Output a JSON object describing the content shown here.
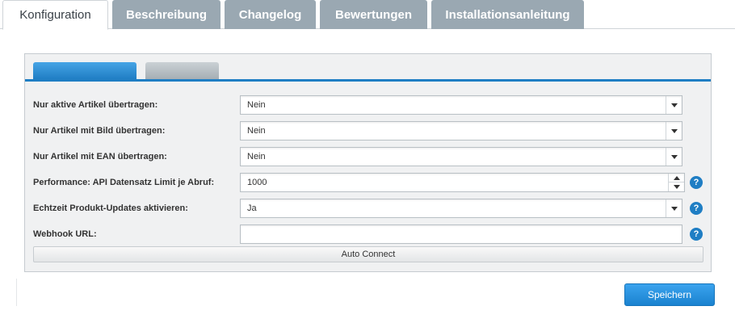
{
  "top_tabs": [
    {
      "label": "Konfiguration",
      "active": true
    },
    {
      "label": "Beschreibung",
      "active": false
    },
    {
      "label": "Changelog",
      "active": false
    },
    {
      "label": "Bewertungen",
      "active": false
    },
    {
      "label": "Installationsanleitung",
      "active": false
    }
  ],
  "form": {
    "rows": [
      {
        "label": "Nur aktive Artikel übertragen:",
        "value": "Nein",
        "type": "select"
      },
      {
        "label": "Nur Artikel mit Bild übertragen:",
        "value": "Nein",
        "type": "select"
      },
      {
        "label": "Nur Artikel mit EAN übertragen:",
        "value": "Nein",
        "type": "select"
      },
      {
        "label": "Performance: API Datensatz Limit je Abruf:",
        "value": "1000",
        "type": "number",
        "help": "?"
      },
      {
        "label": "Echtzeit Produkt-Updates aktivieren:",
        "value": "Ja",
        "type": "select",
        "help": "?"
      },
      {
        "label": "Webhook URL:",
        "value": "",
        "type": "text",
        "help": "?"
      }
    ],
    "auto_connect_label": "Auto Connect"
  },
  "save_label": "Speichern",
  "colors": {
    "accent": "#1f7ec4",
    "tab_inactive": "#9aa8b2",
    "panel_bg": "#f0f1f2"
  }
}
